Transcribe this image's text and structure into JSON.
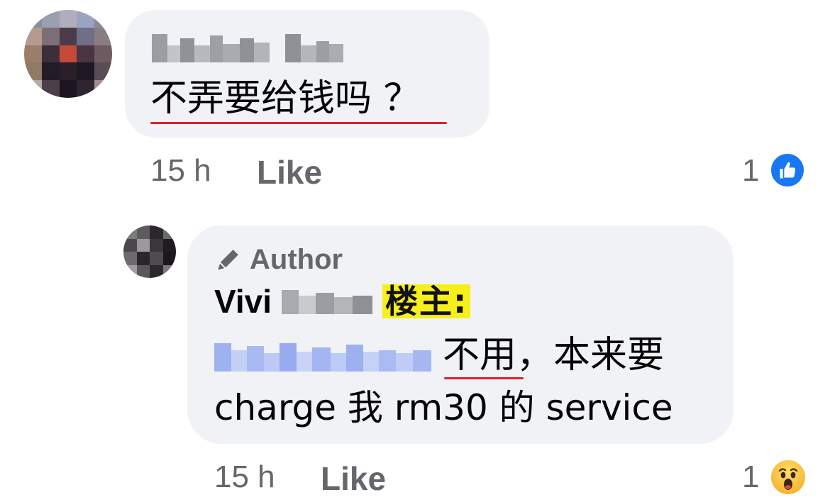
{
  "comment1": {
    "text": "不弄要给钱吗 ？",
    "time": "15 h",
    "like_label": "Like",
    "reaction_count": "1",
    "reaction_icon": "like-icon",
    "reaction_color": "#1877f2"
  },
  "comment2": {
    "badge_label": "Author",
    "badge_icon": "pencil-icon",
    "name_first": "Vivi",
    "tag": "楼主:",
    "text_line1": "不用，本来要",
    "text_line2": "charge 我 rm30 的 service",
    "time": "15 h",
    "like_label": "Like",
    "reaction_count": "1",
    "reaction_icon": "wow-icon",
    "reaction_color": "#f7b125"
  }
}
